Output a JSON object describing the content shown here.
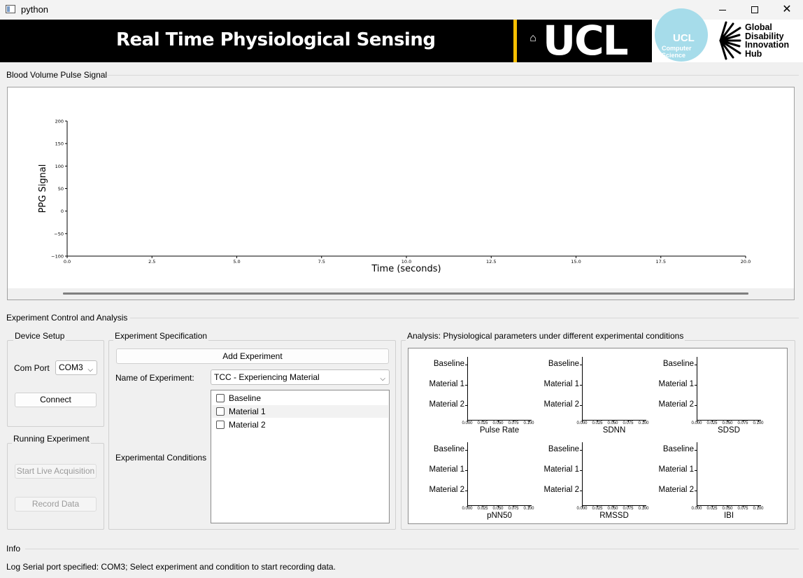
{
  "window": {
    "title": "python"
  },
  "banner": {
    "title": "Real Time Physiological Sensing",
    "ucl_logo": "UCL",
    "cs_logo_ucl": "UCL",
    "cs_logo_line1": "Computer",
    "cs_logo_line2": "Science",
    "gdi_line1": "Global",
    "gdi_line2": "Disability",
    "gdi_line3": "Innovation",
    "gdi_line4": "Hub",
    "accent_color": "#f6be00"
  },
  "bvp": {
    "group_title": "Blood Volume Pulse Signal",
    "chart_data": {
      "type": "line",
      "ylabel": "PPG Signal",
      "xlabel": "Time (seconds)",
      "xlim": [
        0,
        20
      ],
      "ylim": [
        -100,
        200
      ],
      "x_ticks": [
        "0.0",
        "2.5",
        "5.0",
        "7.5",
        "10.0",
        "12.5",
        "15.0",
        "17.5",
        "20.0"
      ],
      "y_ticks": [
        "200",
        "150",
        "100",
        "50",
        "0",
        "−50",
        "−100"
      ],
      "series": []
    }
  },
  "control": {
    "group_title": "Experiment Control and Analysis",
    "device_setup": {
      "title": "Device Setup",
      "com_port_label": "Com Port",
      "com_port_value": "COM3",
      "connect_label": "Connect"
    },
    "running": {
      "title": "Running Experiment",
      "start_label": "Start Live Acquisition",
      "record_label": "Record Data"
    },
    "spec": {
      "title": "Experiment Specification",
      "add_label": "Add Experiment",
      "name_label": "Name of Experiment:",
      "name_value": "TCC - Experiencing Material",
      "conditions_label": "Experimental Conditions",
      "conditions": [
        "Baseline",
        "Material 1",
        "Material 2"
      ]
    },
    "analysis": {
      "title": "Analysis: Physiological parameters under different experimental conditions",
      "chart_data": [
        {
          "type": "bar",
          "xlabel": "Pulse Rate",
          "categories": [
            "Baseline",
            "Material 1",
            "Material 2"
          ],
          "values": [],
          "xlim": [
            0,
            0.1
          ],
          "x_ticks": [
            "0.000",
            "0.025",
            "0.050",
            "0.075",
            "0.100"
          ]
        },
        {
          "type": "bar",
          "xlabel": "SDNN",
          "categories": [
            "Baseline",
            "Material 1",
            "Material 2"
          ],
          "values": [],
          "xlim": [
            0,
            0.1
          ],
          "x_ticks": [
            "0.000",
            "0.025",
            "0.050",
            "0.075",
            "0.100"
          ]
        },
        {
          "type": "bar",
          "xlabel": "SDSD",
          "categories": [
            "Baseline",
            "Material 1",
            "Material 2"
          ],
          "values": [],
          "xlim": [
            0,
            0.1
          ],
          "x_ticks": [
            "0.000",
            "0.025",
            "0.050",
            "0.075",
            "0.100"
          ]
        },
        {
          "type": "bar",
          "xlabel": "pNN50",
          "categories": [
            "Baseline",
            "Material 1",
            "Material 2"
          ],
          "values": [],
          "xlim": [
            0,
            0.1
          ],
          "x_ticks": [
            "0.000",
            "0.025",
            "0.050",
            "0.075",
            "0.100"
          ]
        },
        {
          "type": "bar",
          "xlabel": "RMSSD",
          "categories": [
            "Baseline",
            "Material 1",
            "Material 2"
          ],
          "values": [],
          "xlim": [
            0,
            0.1
          ],
          "x_ticks": [
            "0.000",
            "0.025",
            "0.050",
            "0.075",
            "0.100"
          ]
        },
        {
          "type": "bar",
          "xlabel": "IBI",
          "categories": [
            "Baseline",
            "Material 1",
            "Material 2"
          ],
          "values": [],
          "xlim": [
            0,
            0.1
          ],
          "x_ticks": [
            "0.000",
            "0.025",
            "0.050",
            "0.075",
            "0.100"
          ]
        }
      ]
    }
  },
  "info": {
    "group_title": "Info",
    "log_label": "Log",
    "log_text": "Serial port specified: COM3; Select experiment and condition to start recording data."
  }
}
